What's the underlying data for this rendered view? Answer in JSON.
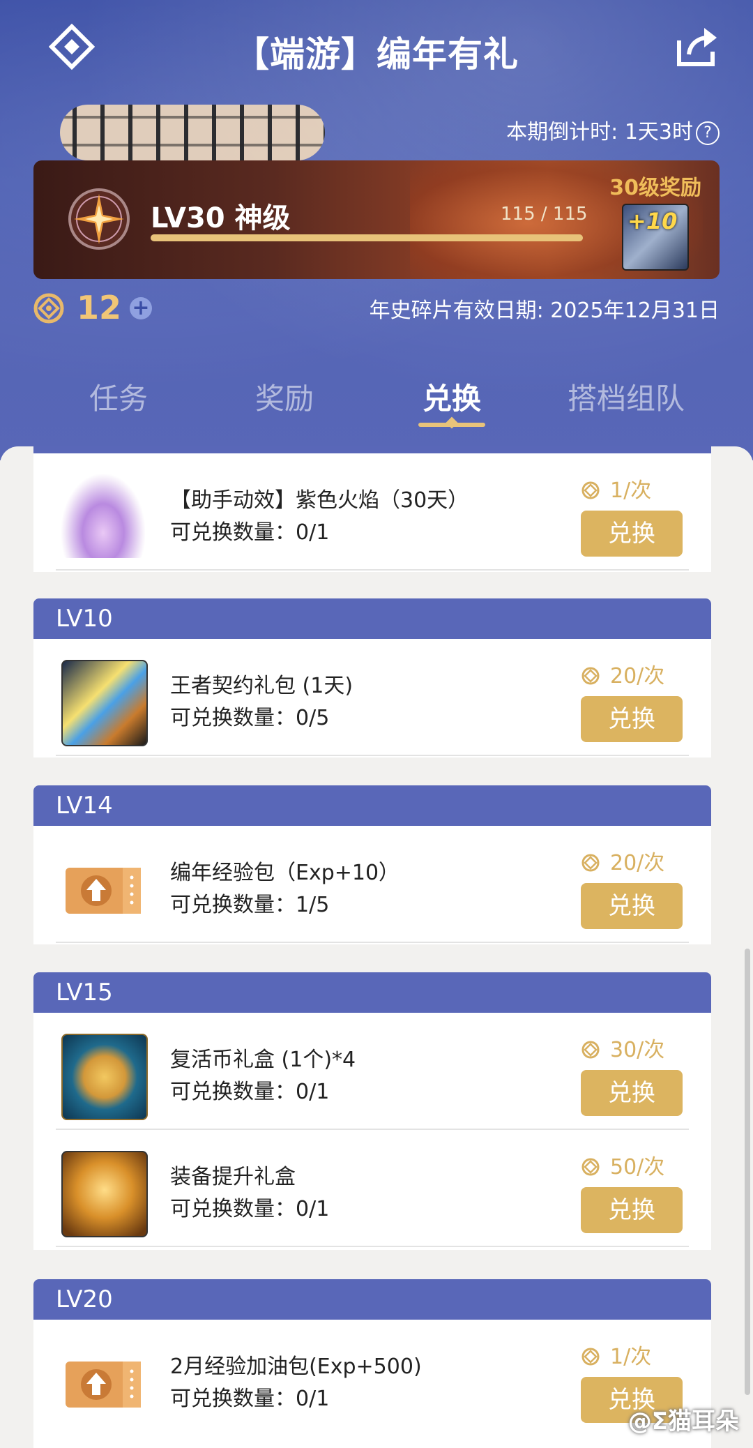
{
  "header": {
    "title": "【端游】编年有礼",
    "countdown": "本期倒计时: 1天3时",
    "help": "?"
  },
  "level": {
    "label": "LV30 神级",
    "xp_text": "115 / 115",
    "xp_progress": 1.0,
    "reward_label": "30级奖励",
    "reward_badge": "+10"
  },
  "wallet": {
    "count": "12",
    "plus": "+",
    "validity": "年史碎片有效日期: 2025年12月31日"
  },
  "tabs": [
    {
      "label": "任务"
    },
    {
      "label": "奖励"
    },
    {
      "label": "兑换"
    },
    {
      "label": "搭档组队"
    }
  ],
  "active_tab": "兑换",
  "groups": [
    {
      "header": "",
      "items": [
        {
          "name": "【助手动效】紫色火焰（30天）",
          "count": "可兑换数量：0/1",
          "price": "1/次",
          "button": "兑换",
          "icon": "purple-flame-icon"
        }
      ]
    },
    {
      "header": "LV10",
      "items": [
        {
          "name": "王者契约礼包 (1天)",
          "count": "可兑换数量：0/5",
          "price": "20/次",
          "button": "兑换",
          "icon": "king-contract-icon"
        }
      ]
    },
    {
      "header": "LV14",
      "items": [
        {
          "name": "编年经验包（Exp+10）",
          "count": "可兑换数量：1/5",
          "price": "20/次",
          "button": "兑换",
          "icon": "exp-ticket-icon"
        }
      ]
    },
    {
      "header": "LV15",
      "items": [
        {
          "name": "复活币礼盒 (1个)*4",
          "count": "可兑换数量：0/1",
          "price": "30/次",
          "button": "兑换",
          "icon": "revive-coin-icon"
        },
        {
          "name": "装备提升礼盒",
          "count": "可兑换数量：0/1",
          "price": "50/次",
          "button": "兑换",
          "icon": "treasure-chest-icon"
        }
      ]
    },
    {
      "header": "LV20",
      "items": [
        {
          "name": "2月经验加油包(Exp+500)",
          "count": "可兑换数量：0/1",
          "price": "1/次",
          "button": "兑换",
          "icon": "exp-ticket-icon"
        }
      ]
    }
  ],
  "watermark": "@Σ猫耳朵",
  "colors": {
    "accent_gold": "#dcb460",
    "header_blue": "#5967b8",
    "hero_blue": "#4a5db2"
  }
}
